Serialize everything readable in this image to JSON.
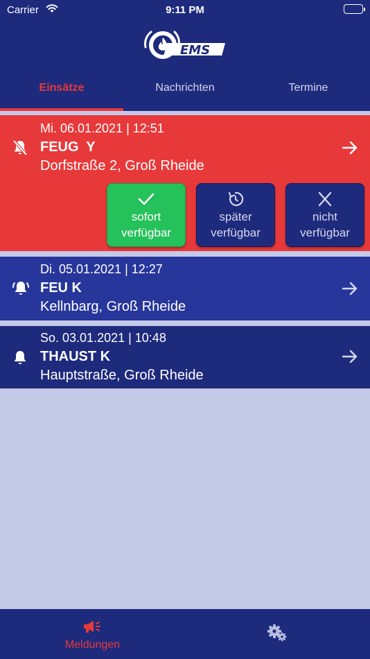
{
  "status_bar": {
    "carrier": "Carrier",
    "time": "9:11 PM"
  },
  "logo": {
    "text": "EMS"
  },
  "tabs": [
    {
      "label": "Einsätze",
      "active": true
    },
    {
      "label": "Nachrichten",
      "active": false
    },
    {
      "label": "Termine",
      "active": false
    }
  ],
  "alarms": [
    {
      "date": "Mi. 06.01.2021 | 12:51",
      "title": "FEUG  Y",
      "address": "Dorfstraße 2, Groß Rheide",
      "icon": "bell-slash-icon",
      "color": "#e8393a",
      "actions": [
        {
          "line1": "sofort",
          "line2": "verfügbar",
          "icon": "checkmark-icon",
          "color": "#25c15a"
        },
        {
          "line1": "später",
          "line2": "verfügbar",
          "icon": "clock-refresh-icon",
          "color": "#1e2a7c"
        },
        {
          "line1": "nicht",
          "line2": "verfügbar",
          "icon": "x-icon",
          "color": "#1e2a7c"
        }
      ]
    },
    {
      "date": "Di. 05.01.2021 | 12:27",
      "title": "FEU K",
      "address": "Kellnbarg, Groß Rheide",
      "icon": "bell-ringing-icon",
      "color": "#27369a"
    },
    {
      "date": "So. 03.01.2021 | 10:48",
      "title": "THAUST K",
      "address": "Hauptstraße, Groß Rheide",
      "icon": "bell-icon",
      "color": "#1e2a7c"
    }
  ],
  "tab_bar": {
    "items": [
      {
        "label": "Meldungen",
        "icon": "megaphone-icon",
        "active": true
      },
      {
        "label": "",
        "icon": "gears-icon",
        "active": false
      }
    ]
  },
  "colors": {
    "header": "#1e2a7c",
    "accent_red": "#e8393a",
    "background": "#c5c9e8"
  }
}
